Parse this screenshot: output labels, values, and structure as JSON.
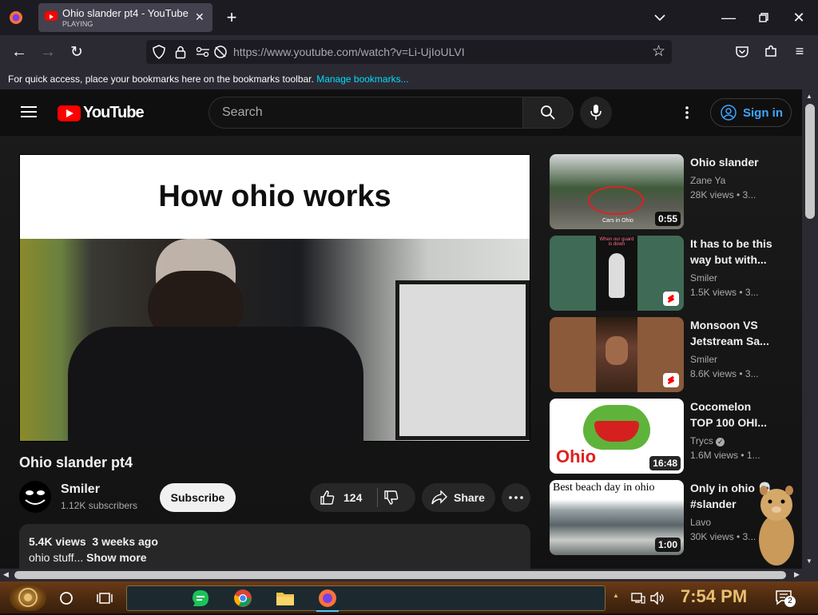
{
  "browser": {
    "tab": {
      "title": "Ohio slander pt4 - YouTube",
      "status": "PLAYING"
    },
    "url": "https://www.youtube.com/watch?v=Li-UjIoULVI",
    "bookmarks_hint": "For quick access, place your bookmarks here on the bookmarks toolbar.",
    "bookmarks_link": "Manage bookmarks..."
  },
  "youtube": {
    "logo_text": "YouTube",
    "search_placeholder": "Search",
    "signin_label": "Sign in",
    "accent": "#ff0000"
  },
  "video": {
    "caption": "How ohio works",
    "title": "Ohio slander pt4",
    "channel": "Smiler",
    "subscribers": "1.12K subscribers",
    "subscribe_label": "Subscribe",
    "likes": "124",
    "share_label": "Share",
    "views": "5.4K views",
    "age": "3 weeks ago",
    "description": "ohio stuff...",
    "show_more": "Show more"
  },
  "recommendations": [
    {
      "title1": "Ohio slander",
      "title2": "",
      "channel": "Zane Ya",
      "meta": "28K views • 3...",
      "duration": "0:55",
      "thumb_text": "Cars in Ohio"
    },
    {
      "title1": "It has to be this",
      "title2": "way but with...",
      "channel": "Smiler",
      "meta": "1.5K views • 3...",
      "thumb_text": "When our guard is down"
    },
    {
      "title1": "Monsoon VS",
      "title2": "Jetstream Sa...",
      "channel": "Smiler",
      "meta": "8.6K views • 3..."
    },
    {
      "title1": "Cocomelon",
      "title2": "TOP 100 OHI...",
      "channel": "Trycs",
      "meta": "1.6M views • 1...",
      "duration": "16:48",
      "thumb_text": "Ohio"
    },
    {
      "title1": "Only in ohio 💀",
      "title2": "#slander",
      "channel": "Lavo",
      "meta": "30K views • 3...",
      "duration": "1:00",
      "thumb_text": "Best beach day in ohio"
    }
  ],
  "taskbar": {
    "time": "7:54 PM",
    "notifications": "2"
  }
}
